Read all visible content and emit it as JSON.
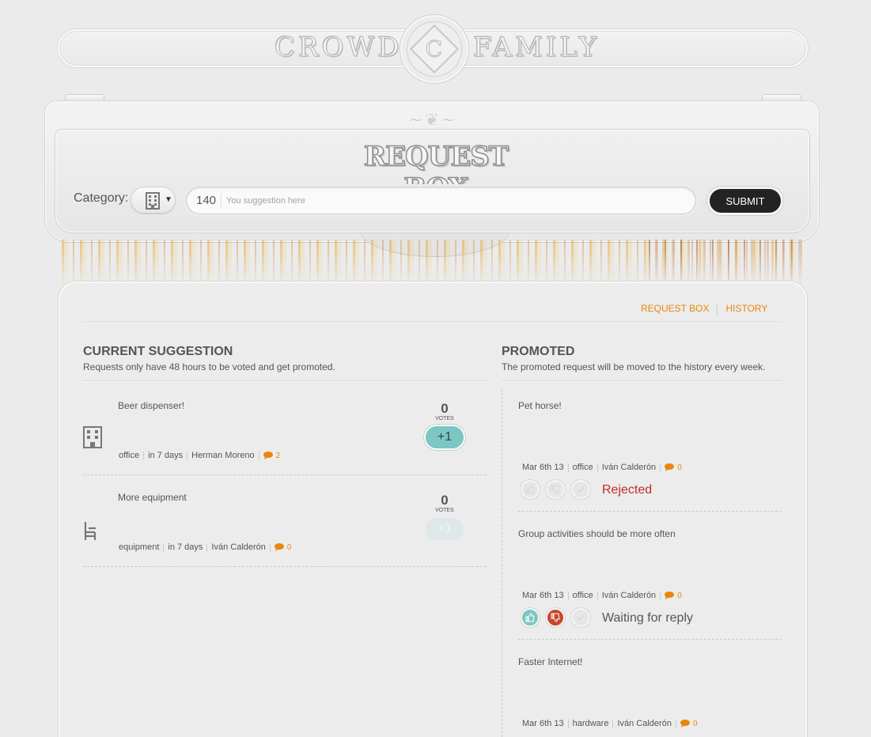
{
  "logo": {
    "left_word": "CROWD",
    "right_word": "FAMILY",
    "emblem_letter": "C"
  },
  "request_box": {
    "title": "REQUEST BOX",
    "category_label": "Category:",
    "category_icon": "building-icon",
    "char_count": "140",
    "placeholder": "You suggestion here",
    "submit_label": "SUBMIT"
  },
  "nav": {
    "request_box": "REQUEST BOX",
    "history": "HISTORY"
  },
  "current": {
    "title": "CURRENT SUGGESTION",
    "subtitle": "Requests only have 48 hours to be voted and get promoted.",
    "votes_label": "VOTES",
    "vote_button": "+1",
    "items": [
      {
        "title": "Beer dispenser!",
        "category": "office",
        "time": "in 7 days",
        "author": "Herman Moreno",
        "comments": "2",
        "votes": "0",
        "icon": "building-icon"
      },
      {
        "title": "More equipment",
        "category": "equipment",
        "time": "in 7 days",
        "author": "Iván Calderón",
        "comments": "0",
        "votes": "0",
        "icon": "chair-icon"
      }
    ]
  },
  "promoted": {
    "title": "PROMOTED",
    "subtitle": "The promoted request will be moved to the history every week.",
    "items": [
      {
        "title": "Pet horse!",
        "date": "Mar 6th 13",
        "category": "office",
        "author": "Iván Calderón",
        "comments": "0",
        "status": "Rejected"
      },
      {
        "title": "Group activities should be more often",
        "date": "Mar 6th 13",
        "category": "office",
        "author": "Iván Calderón",
        "comments": "0",
        "status": "Waiting for reply"
      },
      {
        "title": "Faster Internet!",
        "date": "Mar 6th 13",
        "category": "hardware",
        "author": "Iván Calderón",
        "comments": "0"
      }
    ]
  },
  "colors": {
    "accent": "#e8860c",
    "teal": "#7cc6c4",
    "rejected": "#c32a2a",
    "dislike": "#c9472f",
    "submit_bg": "#232323"
  }
}
